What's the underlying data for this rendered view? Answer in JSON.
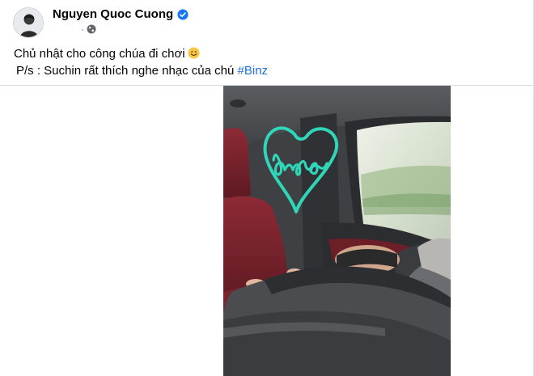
{
  "post": {
    "author": "Nguyen Quoc Cuong",
    "caption_line1": "Chủ nhật cho công chúa đi chơi",
    "caption_line2_prefix": "P/s : Suchin rất thích nghe nhạc của chú",
    "hashtag": "#Binz",
    "meta_separator": "·",
    "icons": {
      "verified": "verified-badge-icon",
      "privacy": "globe-icon",
      "emoji": "smiling-face-emoji"
    }
  },
  "video": {
    "sticker_text": "babe"
  },
  "colors": {
    "link": "#216fdb",
    "verified": "#1877f2",
    "sticker": "#2fd6b8"
  }
}
